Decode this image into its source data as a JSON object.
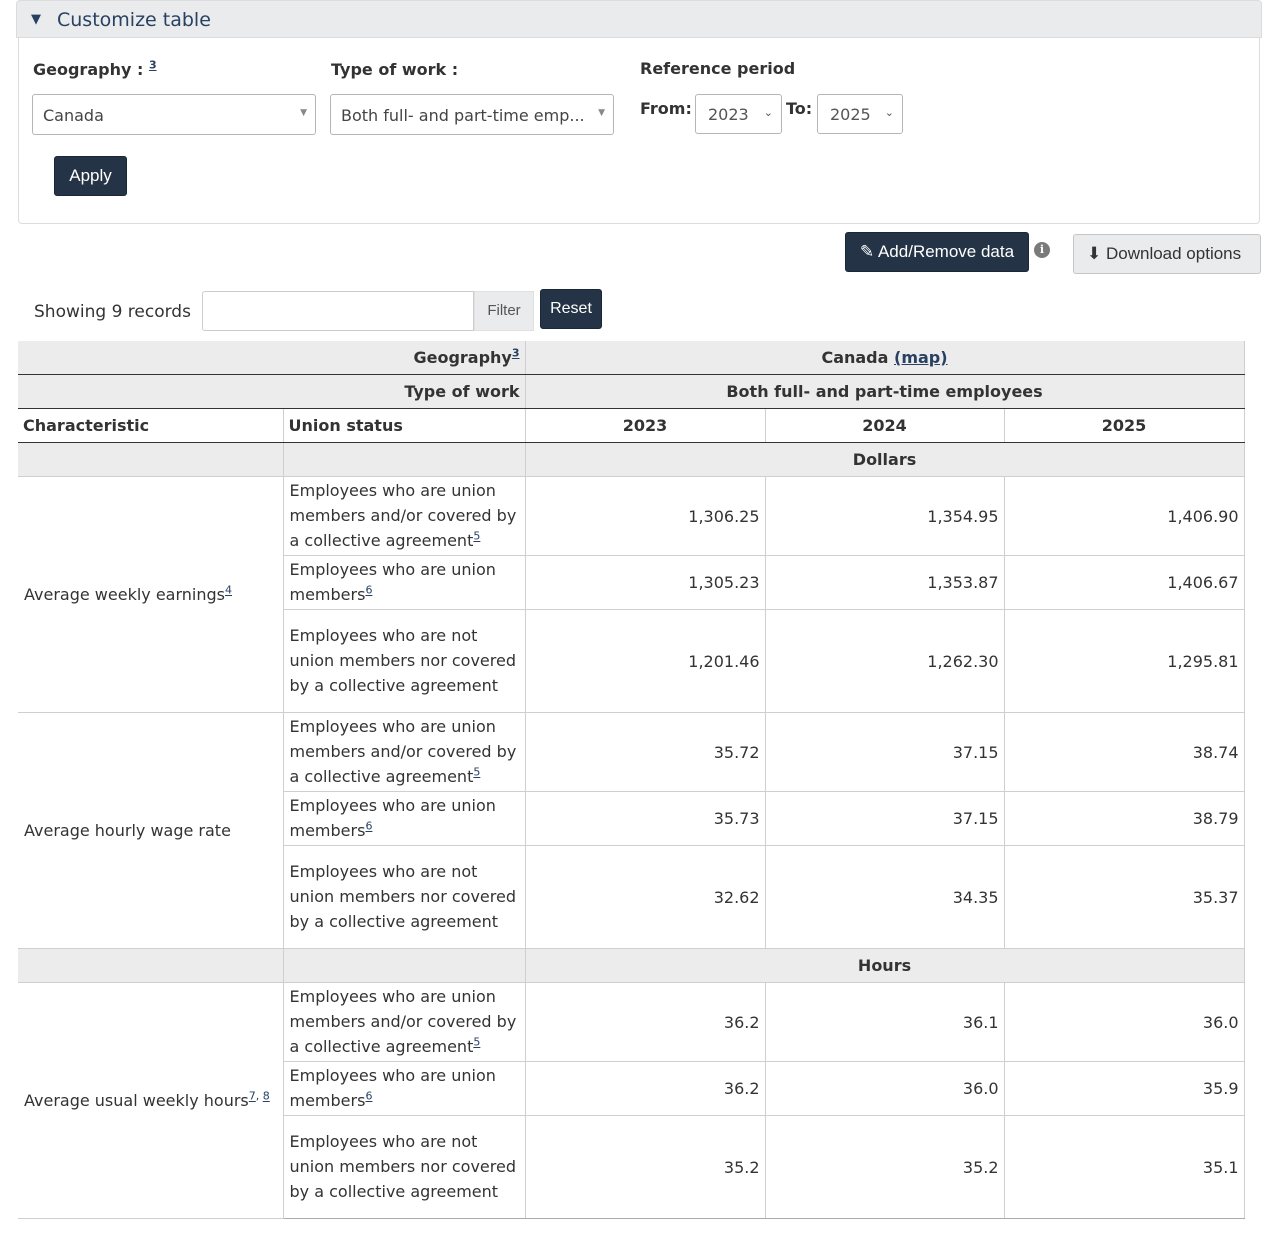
{
  "panel": {
    "title": "Customize table"
  },
  "controls": {
    "geography_label": "Geography :",
    "geography_fn": "3",
    "geography_value": "Canada",
    "work_label": "Type of work :",
    "work_value": "Both full- and part-time emp...",
    "ref_label": "Reference period",
    "from_label": "From:",
    "from_value": "2023",
    "to_label": "To:",
    "to_value": "2025",
    "apply": "Apply"
  },
  "actions": {
    "add_remove": "Add/Remove data",
    "download": "Download options"
  },
  "filter": {
    "showing": "Showing 9 records",
    "filter_label": "Filter",
    "reset_label": "Reset"
  },
  "table": {
    "geo_label": "Geography",
    "geo_fn": "3",
    "geo_value": "Canada",
    "map_link": "(map)",
    "work_label": "Type of work",
    "work_value": "Both full- and part-time employees",
    "col_char": "Characteristic",
    "col_union": "Union status",
    "years": [
      "2023",
      "2024",
      "2025"
    ],
    "unit_dollars": "Dollars",
    "unit_hours": "Hours",
    "status": {
      "a": "Employees who are union members and/or covered by a collective agreement",
      "a_fn": "5",
      "b": "Employees who are union members",
      "b_fn": "6",
      "c": "Employees who are not union members nor covered by a collective agreement"
    },
    "groups": [
      {
        "name": "Average weekly earnings",
        "fn": "4",
        "rows": [
          [
            "1,306.25",
            "1,354.95",
            "1,406.90"
          ],
          [
            "1,305.23",
            "1,353.87",
            "1,406.67"
          ],
          [
            "1,201.46",
            "1,262.30",
            "1,295.81"
          ]
        ]
      },
      {
        "name": "Average hourly wage rate",
        "fn": "",
        "rows": [
          [
            "35.72",
            "37.15",
            "38.74"
          ],
          [
            "35.73",
            "37.15",
            "38.79"
          ],
          [
            "32.62",
            "34.35",
            "35.37"
          ]
        ]
      },
      {
        "name": "Average usual weekly hours",
        "fn": "7",
        "fn2": "8",
        "rows": [
          [
            "36.2",
            "36.1",
            "36.0"
          ],
          [
            "36.2",
            "36.0",
            "35.9"
          ],
          [
            "35.2",
            "35.2",
            "35.1"
          ]
        ]
      }
    ]
  }
}
